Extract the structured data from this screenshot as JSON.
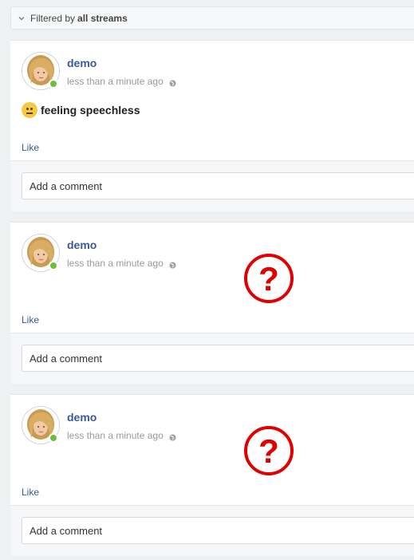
{
  "filter": {
    "prefix": "Filtered by",
    "value": "all streams"
  },
  "posts": [
    {
      "author": "demo",
      "time": "less than a minute ago",
      "status": "feeling speechless",
      "like_label": "Like",
      "comment_placeholder": "Add a comment",
      "unknown_attachment": false
    },
    {
      "author": "demo",
      "time": "less than a minute ago",
      "status": "",
      "like_label": "Like",
      "comment_placeholder": "Add a comment",
      "unknown_attachment": true
    },
    {
      "author": "demo",
      "time": "less than a minute ago",
      "status": "",
      "like_label": "Like",
      "comment_placeholder": "Add a comment",
      "unknown_attachment": true
    }
  ],
  "icons": {
    "filter_toggle": "chevron-down-icon",
    "privacy": "globe-icon",
    "mood": "neutral-face-icon",
    "missing_content": "question-mark-icon",
    "presence": "online-dot-icon"
  },
  "colors": {
    "link": "#3b5998",
    "online": "#6bbf3b",
    "missing": "#e00000"
  }
}
